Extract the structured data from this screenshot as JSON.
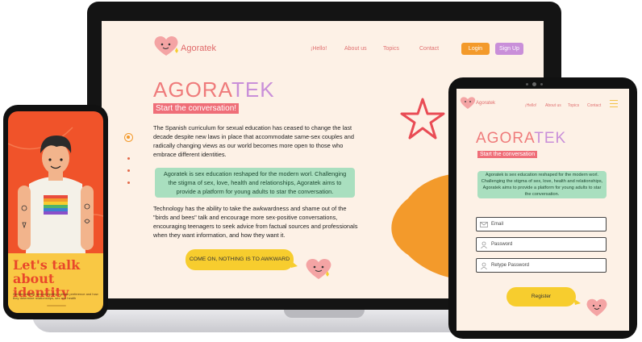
{
  "laptop": {
    "brand": "Agoratek",
    "nav": [
      "¡Hello!",
      "About us",
      "Topics",
      "Contact"
    ],
    "login_label": "Login",
    "signup_label": "Sign Up",
    "title_a": "AGORA",
    "title_b": "TEK",
    "tagline": "Start the conversation!",
    "paragraph1": "The Spanish curriculum for sexual education has ceased to change the last decade despite new laws in place that accommodate same-sex couples and radically changing views as our world becomes more open to those who embrace different identities.",
    "green_text": "Agoratek is sex education reshaped for the modern worl. Challenging the stigma of sex, love, health and relationships, Agoratek aims to provide a platform for young adults to star the conversation.",
    "paragraph2": "Technology has the ability to take the awkwardness and shame out of the \"birds and bees\" talk and encourage more sex-positive conversations, encouraging teenagers to seek advice from factual sources and professionals when they want information, and how they want it.",
    "cta": "COME ON, NOTHING IS TO AWKWARD"
  },
  "phone": {
    "title": "Let's talk about identity",
    "subtitle": "Gender identity, sexual identity, cultural preference and how they determine relationships, sex and health"
  },
  "tablet": {
    "brand": "Agoratek",
    "nav": [
      "¡Hello!",
      "About us",
      "Topics",
      "Contact"
    ],
    "title_a": "AGORA",
    "title_b": "TEK",
    "tagline": "Start the conversation",
    "green_text": "Agoratek is sex education reshaped for the modern worl. Challenging the stigma of sex, love, health and relationships, Agoratek aims to provide a platform for young adults to star the conversation.",
    "email_placeholder": "Email",
    "password_placeholder": "Password",
    "retype_placeholder": "Retype Password",
    "register_label": "Register"
  },
  "colors": {
    "accent_pink": "#ef6e78",
    "accent_purple": "#c98fd9",
    "accent_orange": "#f39a2b",
    "accent_yellow": "#f7cd2e",
    "accent_green": "#a9dfbf",
    "background": "#fdf1e6"
  },
  "icons": [
    "heart-logo-icon",
    "hamburger-menu-icon",
    "mail-icon",
    "user-icon",
    "star-icon"
  ]
}
